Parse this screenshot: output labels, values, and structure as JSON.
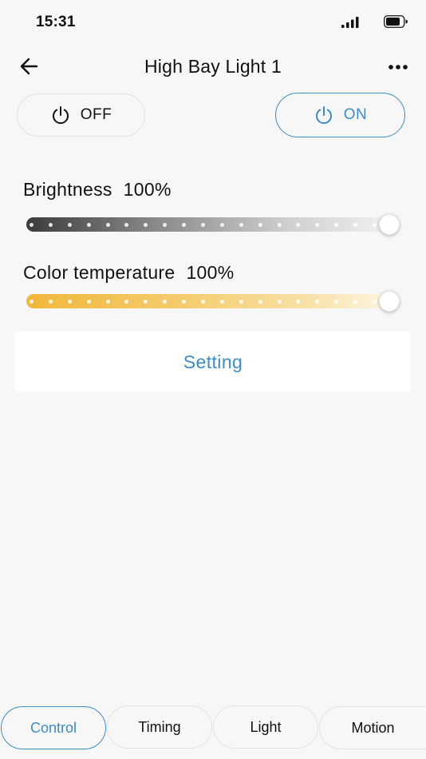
{
  "status_bar": {
    "time": "15:31"
  },
  "header": {
    "title": "High Bay Light 1"
  },
  "power": {
    "off_label": "OFF",
    "on_label": "ON"
  },
  "brightness": {
    "label": "Brightness",
    "value_text": "100%",
    "level": 1.0
  },
  "color_temperature": {
    "label": "Color temperature",
    "value_text": "100%",
    "level": 1.0
  },
  "setting": {
    "label": "Setting"
  },
  "tabs": [
    {
      "label": "Control",
      "active": true
    },
    {
      "label": "Timing",
      "active": false
    },
    {
      "label": "Light",
      "active": false
    },
    {
      "label": "Motion",
      "active": false
    }
  ],
  "colors": {
    "accent": "#3b8dc8",
    "warm": "#f1b73b"
  },
  "icons": [
    "signal-icon",
    "battery-icon",
    "back-arrow-icon",
    "more-icon",
    "power-icon"
  ]
}
